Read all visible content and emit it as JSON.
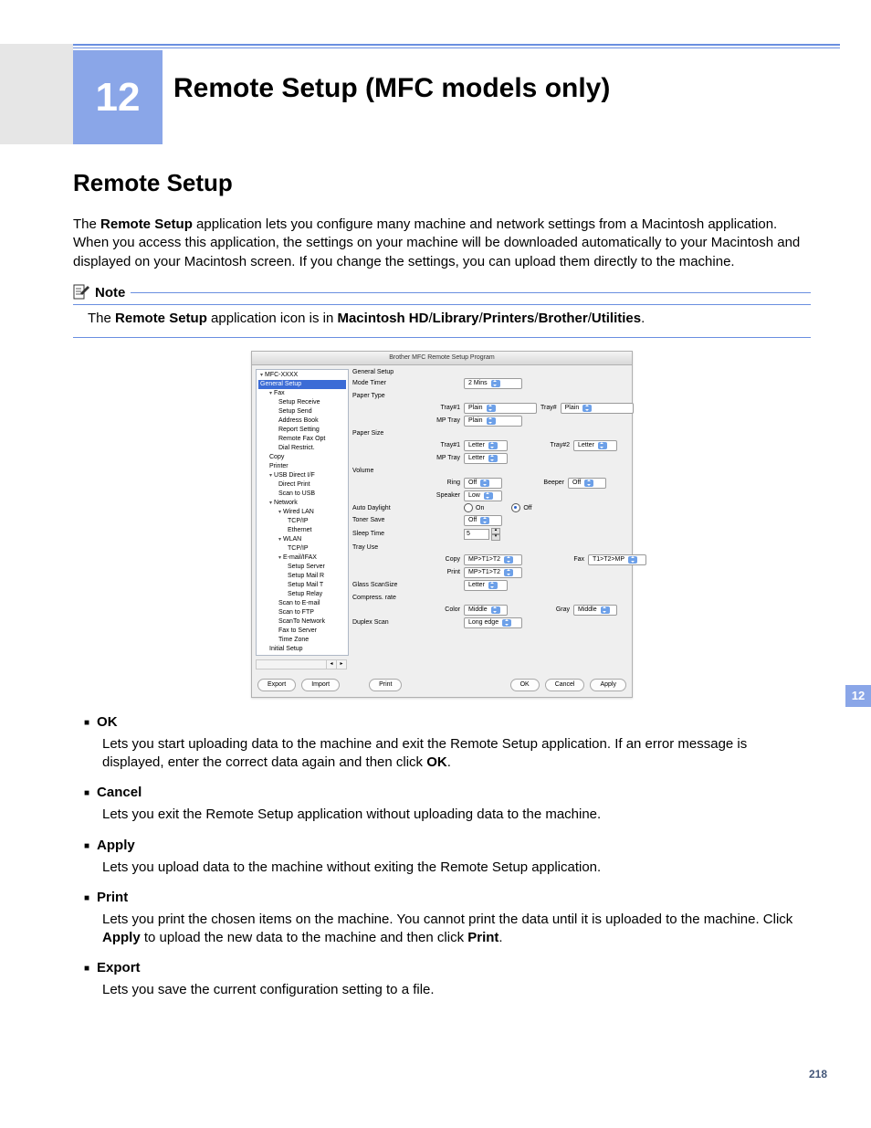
{
  "chapter": {
    "number": "12",
    "title": "Remote Setup (MFC models only)"
  },
  "section_heading": "Remote Setup",
  "intro": {
    "p1_a": "The ",
    "p1_b": "Remote Setup",
    "p1_c": " application lets you configure many machine and network settings from a Macintosh application. When you access this application, the settings on your machine will be downloaded automatically to your Macintosh and displayed on your Macintosh screen. If you change the settings, you can upload them directly to the machine."
  },
  "note": {
    "label": "Note",
    "line_a": "The ",
    "line_b": "Remote Setup",
    "line_c": " application icon is in ",
    "path_1": "Macintosh HD",
    "path_2": "Library",
    "path_3": "Printers",
    "path_4": "Brother",
    "path_5": "Utilities",
    "slash": "/",
    "dot": "."
  },
  "app": {
    "title": "Brother MFC Remote Setup Program",
    "tree": {
      "root": "MFC-XXXX",
      "items": [
        {
          "label": "General Setup",
          "type": "item",
          "selected": true,
          "indent": 1
        },
        {
          "label": "Fax",
          "type": "group",
          "indent": 1
        },
        {
          "label": "Setup Receive",
          "type": "item",
          "indent": 2
        },
        {
          "label": "Setup Send",
          "type": "item",
          "indent": 2
        },
        {
          "label": "Address Book",
          "type": "item",
          "indent": 2
        },
        {
          "label": "Report Setting",
          "type": "item",
          "indent": 2
        },
        {
          "label": "Remote Fax Opt",
          "type": "item",
          "indent": 2
        },
        {
          "label": "Dial Restrict.",
          "type": "item",
          "indent": 2
        },
        {
          "label": "Copy",
          "type": "item",
          "indent": 1
        },
        {
          "label": "Printer",
          "type": "item",
          "indent": 1
        },
        {
          "label": "USB Direct I/F",
          "type": "group",
          "indent": 1
        },
        {
          "label": "Direct Print",
          "type": "item",
          "indent": 2
        },
        {
          "label": "Scan to USB",
          "type": "item",
          "indent": 2
        },
        {
          "label": "Network",
          "type": "group",
          "indent": 1
        },
        {
          "label": "Wired LAN",
          "type": "group",
          "indent": 2
        },
        {
          "label": "TCP/IP",
          "type": "item",
          "indent": 3
        },
        {
          "label": "Ethernet",
          "type": "item",
          "indent": 3
        },
        {
          "label": "WLAN",
          "type": "group",
          "indent": 2
        },
        {
          "label": "TCP/IP",
          "type": "item",
          "indent": 3
        },
        {
          "label": "E-mail/IFAX",
          "type": "group",
          "indent": 2
        },
        {
          "label": "Setup Server",
          "type": "item",
          "indent": 3
        },
        {
          "label": "Setup Mail R",
          "type": "item",
          "indent": 3
        },
        {
          "label": "Setup Mail T",
          "type": "item",
          "indent": 3
        },
        {
          "label": "Setup Relay",
          "type": "item",
          "indent": 3
        },
        {
          "label": "Scan to E-mail",
          "type": "item",
          "indent": 2
        },
        {
          "label": "Scan to FTP",
          "type": "item",
          "indent": 2
        },
        {
          "label": "ScanTo Network",
          "type": "item",
          "indent": 2
        },
        {
          "label": "Fax to Server",
          "type": "item",
          "indent": 2
        },
        {
          "label": "Time Zone",
          "type": "item",
          "indent": 2
        },
        {
          "label": "Initial Setup",
          "type": "item",
          "indent": 1
        }
      ]
    },
    "form": {
      "title": "General Setup",
      "mode_timer": {
        "label": "Mode Timer",
        "value": "2 Mins"
      },
      "paper_type": {
        "label": "Paper Type",
        "tray1": {
          "label": "Tray#1",
          "value": "Plain"
        },
        "tray_pound": {
          "label": "Tray#",
          "value": "Plain"
        },
        "mptray": {
          "label": "MP Tray",
          "value": "Plain"
        }
      },
      "paper_size": {
        "label": "Paper Size",
        "tray1": {
          "label": "Tray#1",
          "value": "Letter"
        },
        "tray2": {
          "label": "Tray#2",
          "value": "Letter"
        },
        "mptray": {
          "label": "MP Tray",
          "value": "Letter"
        }
      },
      "volume": {
        "label": "Volume",
        "ring": {
          "label": "Ring",
          "value": "Off"
        },
        "beeper": {
          "label": "Beeper",
          "value": "Off"
        },
        "speaker": {
          "label": "Speaker",
          "value": "Low"
        }
      },
      "auto_daylight": {
        "label": "Auto Daylight",
        "on": "On",
        "off": "Off",
        "selected": "Off"
      },
      "toner_save": {
        "label": "Toner Save",
        "value": "Off"
      },
      "sleep_time": {
        "label": "Sleep Time",
        "value": "5"
      },
      "tray_use": {
        "label": "Tray Use",
        "copy": {
          "label": "Copy",
          "value": "MP>T1>T2"
        },
        "fax": {
          "label": "Fax",
          "value": "T1>T2>MP"
        },
        "print": {
          "label": "Print",
          "value": "MP>T1>T2"
        }
      },
      "glass_scansize": {
        "label": "Glass ScanSize",
        "value": "Letter"
      },
      "compress_rate": {
        "label": "Compress. rate",
        "color": {
          "label": "Color",
          "value": "Middle"
        },
        "gray": {
          "label": "Gray",
          "value": "Middle"
        }
      },
      "duplex_scan": {
        "label": "Duplex Scan",
        "value": "Long edge"
      }
    },
    "buttons": {
      "export": "Export",
      "import": "Import",
      "print": "Print",
      "ok": "OK",
      "cancel": "Cancel",
      "apply": "Apply"
    }
  },
  "definitions": [
    {
      "term": "OK",
      "desc_a": "Lets you start uploading data to the machine and exit the Remote Setup application. If an error message is displayed, enter the correct data again and then click ",
      "desc_bold": "OK",
      "desc_b": "."
    },
    {
      "term": "Cancel",
      "desc_a": "Lets you exit the Remote Setup application without uploading data to the machine.",
      "desc_bold": "",
      "desc_b": ""
    },
    {
      "term": "Apply",
      "desc_a": "Lets you upload data to the machine without exiting the Remote Setup application.",
      "desc_bold": "",
      "desc_b": ""
    },
    {
      "term": "Print",
      "desc_a": "Lets you print the chosen items on the machine. You cannot print the data until it is uploaded to the machine. Click ",
      "desc_bold": "Apply",
      "desc_b": " to upload the new data to the machine and then click ",
      "desc_bold2": "Print",
      "desc_c": "."
    },
    {
      "term": "Export",
      "desc_a": "Lets you save the current configuration setting to a file.",
      "desc_bold": "",
      "desc_b": ""
    }
  ],
  "side_tab": "12",
  "page_number": "218"
}
